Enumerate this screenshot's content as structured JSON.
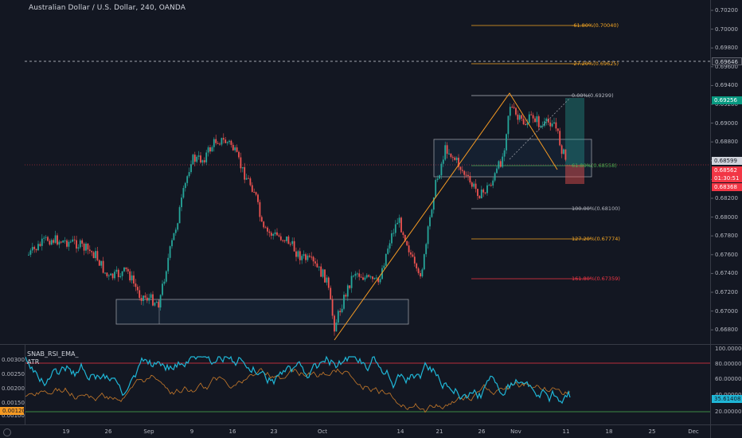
{
  "header": {
    "title": "Australian Dollar / U.S. Dollar, 240, OANDA"
  },
  "indicators": {
    "rsi_label": "SNAB_RSI_EMA_",
    "atr_label": "ATR"
  },
  "price_axis": {
    "ticks": [
      "0.70200",
      "0.70000",
      "0.69800",
      "0.69600",
      "0.69400",
      "0.69200",
      "0.69000",
      "0.68800",
      "0.68600",
      "0.68400",
      "0.68200",
      "0.68000",
      "0.67800",
      "0.67600",
      "0.67400",
      "0.67200",
      "0.67000",
      "0.66800"
    ],
    "tags": {
      "dashed_line": "0.69646",
      "high": "0.69256",
      "price1": "0.68599",
      "price2": "0.68562",
      "countdown": "01:30:51",
      "low": "0.68368"
    }
  },
  "indicator_axis": {
    "right_ticks": [
      "100.00000",
      "80.00000",
      "60.00000",
      "40.00000",
      "20.00000"
    ],
    "left_ticks": [
      "0.00300",
      "0.00250",
      "0.00200",
      "0.00150",
      "0.00100"
    ],
    "rsi_tag": "35.61408",
    "atr_tag": "0.00120"
  },
  "time_axis": {
    "ticks": [
      "19",
      "26",
      "Sep",
      "9",
      "16",
      "23",
      "Oct",
      "14",
      "21",
      "26",
      "Nov",
      "11",
      "18",
      "25",
      "Dec"
    ]
  },
  "fibonacci": [
    {
      "label": "-61.80%(0.70040)",
      "color": "#f5a623"
    },
    {
      "label": "-27.20%(0.69625)",
      "color": "#f5a623"
    },
    {
      "label": "0.00%(0.69299)",
      "color": "#b2b5be"
    },
    {
      "label": "61.80%(0.68558)",
      "color": "#4caf50"
    },
    {
      "label": "100.00%(0.68100)",
      "color": "#b2b5be"
    },
    {
      "label": "127.20%(0.67774)",
      "color": "#f5a623"
    },
    {
      "label": "161.80%(0.67359)",
      "color": "#f23645"
    }
  ],
  "colors": {
    "bg": "#131722",
    "up": "#26a69a",
    "down": "#ef5350",
    "rsi": "#1fb6d6",
    "atr": "#c87a2a",
    "ob_line": "#f23645",
    "os_line": "#4caf50",
    "drawing": "#f59a23"
  }
}
